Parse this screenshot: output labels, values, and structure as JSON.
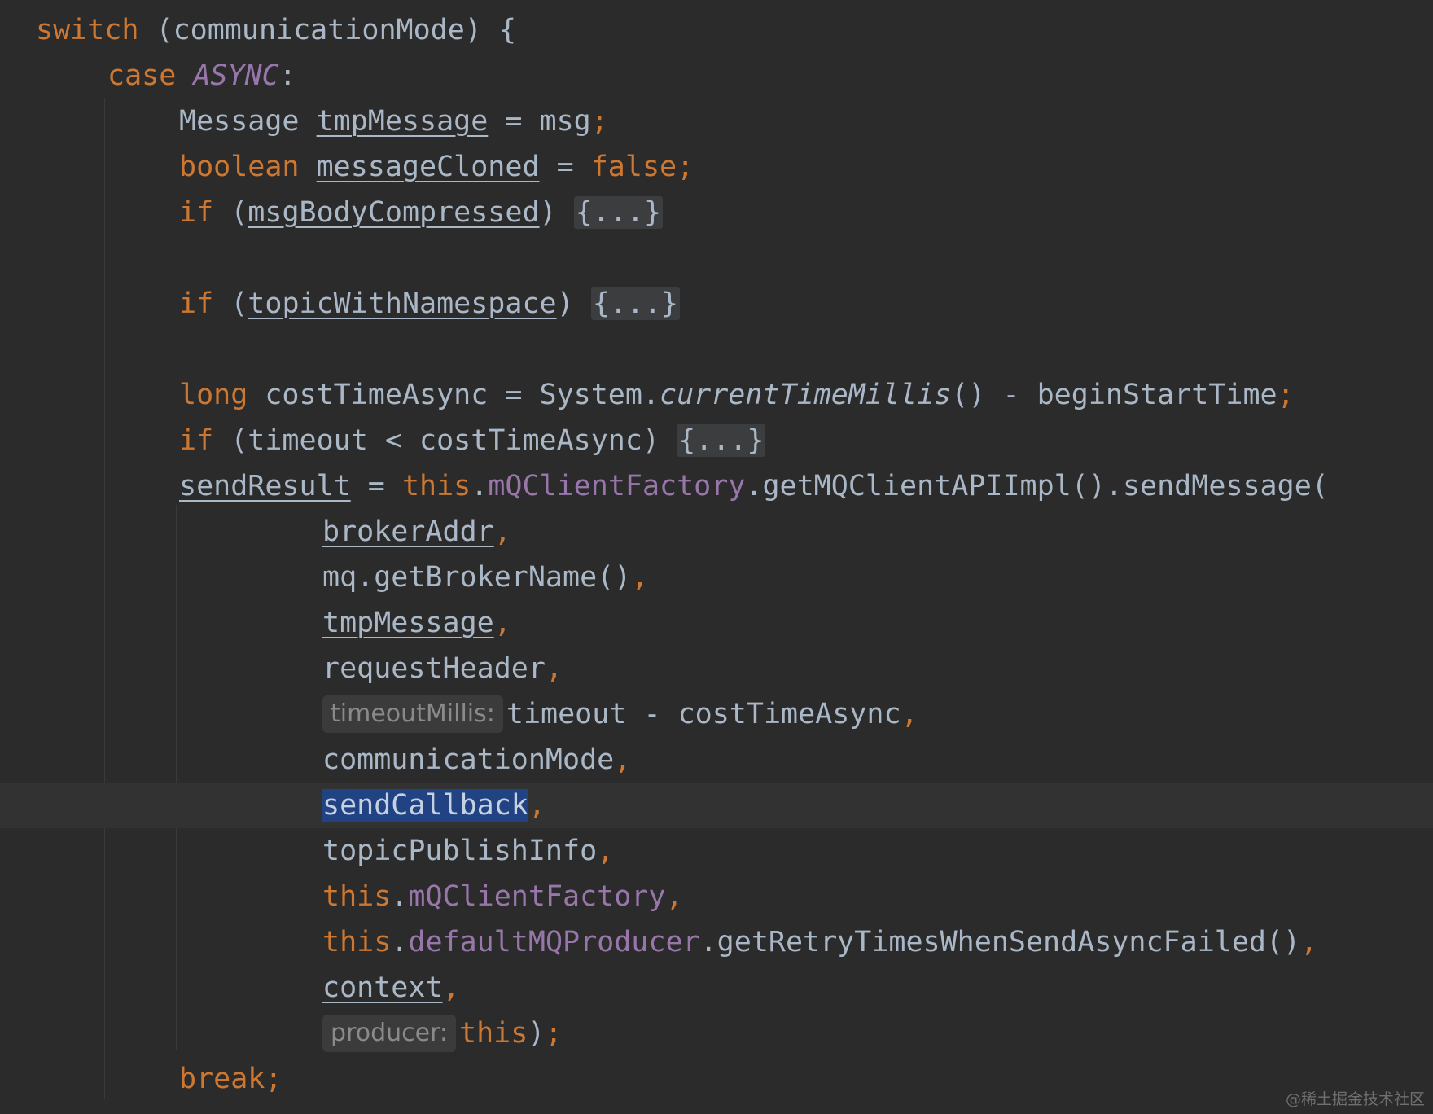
{
  "colors": {
    "background": "#2b2b2b",
    "keyword": "#cc7832",
    "identifier": "#a9b7c6",
    "field": "#9876aa",
    "selection": "#214283",
    "hint_text": "#8a8a8a"
  },
  "code_lines": [
    {
      "indent": 0,
      "tokens": [
        {
          "t": "switch",
          "c": "kw"
        },
        {
          "t": " (communicationMode) {",
          "c": "plain"
        }
      ]
    },
    {
      "indent": 1,
      "tokens": [
        {
          "t": "case ",
          "c": "kw"
        },
        {
          "t": "ASYNC",
          "c": "enum"
        },
        {
          "t": ":",
          "c": "plain"
        }
      ]
    },
    {
      "indent": 2,
      "tokens": [
        {
          "t": "Message ",
          "c": "plain"
        },
        {
          "t": "tmpMessage",
          "c": "plain u"
        },
        {
          "t": " = msg",
          "c": "plain"
        },
        {
          "t": ";",
          "c": "kw"
        }
      ]
    },
    {
      "indent": 2,
      "tokens": [
        {
          "t": "boolean ",
          "c": "kw"
        },
        {
          "t": "messageCloned",
          "c": "plain u"
        },
        {
          "t": " = ",
          "c": "plain"
        },
        {
          "t": "false",
          "c": "kw"
        },
        {
          "t": ";",
          "c": "kw"
        }
      ]
    },
    {
      "indent": 2,
      "tokens": [
        {
          "t": "if ",
          "c": "kw"
        },
        {
          "t": "(",
          "c": "plain"
        },
        {
          "t": "msgBodyCompressed",
          "c": "plain u"
        },
        {
          "t": ") ",
          "c": "plain"
        },
        {
          "t": "{...}",
          "c": "fold"
        }
      ]
    },
    {
      "indent": 2,
      "tokens": []
    },
    {
      "indent": 2,
      "tokens": [
        {
          "t": "if ",
          "c": "kw"
        },
        {
          "t": "(",
          "c": "plain"
        },
        {
          "t": "topicWithNamespace",
          "c": "plain u"
        },
        {
          "t": ") ",
          "c": "plain"
        },
        {
          "t": "{...}",
          "c": "fold"
        }
      ]
    },
    {
      "indent": 2,
      "tokens": []
    },
    {
      "indent": 2,
      "tokens": [
        {
          "t": "long ",
          "c": "kw"
        },
        {
          "t": "costTimeAsync = System.",
          "c": "plain"
        },
        {
          "t": "currentTimeMillis",
          "c": "static-call"
        },
        {
          "t": "() - beginStartTime",
          "c": "plain"
        },
        {
          "t": ";",
          "c": "kw"
        }
      ]
    },
    {
      "indent": 2,
      "tokens": [
        {
          "t": "if ",
          "c": "kw"
        },
        {
          "t": "(timeout < costTimeAsync) ",
          "c": "plain"
        },
        {
          "t": "{...}",
          "c": "fold"
        }
      ]
    },
    {
      "indent": 2,
      "tokens": [
        {
          "t": "sendResult",
          "c": "plain u"
        },
        {
          "t": " = ",
          "c": "plain"
        },
        {
          "t": "this",
          "c": "kw"
        },
        {
          "t": ".",
          "c": "plain"
        },
        {
          "t": "mQClientFactory",
          "c": "field"
        },
        {
          "t": ".getMQClientAPIImpl().sendMessage(",
          "c": "plain"
        }
      ]
    },
    {
      "indent": 4,
      "tokens": [
        {
          "t": "brokerAddr",
          "c": "plain u"
        },
        {
          "t": ",",
          "c": "kw"
        }
      ]
    },
    {
      "indent": 4,
      "tokens": [
        {
          "t": "mq.getBrokerName()",
          "c": "plain"
        },
        {
          "t": ",",
          "c": "kw"
        }
      ]
    },
    {
      "indent": 4,
      "tokens": [
        {
          "t": "tmpMessage",
          "c": "plain u"
        },
        {
          "t": ",",
          "c": "kw"
        }
      ]
    },
    {
      "indent": 4,
      "tokens": [
        {
          "t": "requestHeader",
          "c": "plain"
        },
        {
          "t": ",",
          "c": "kw"
        }
      ]
    },
    {
      "indent": 4,
      "tokens": [
        {
          "t": "timeoutMillis:",
          "c": "hint"
        },
        {
          "t": "timeout - costTimeAsync",
          "c": "plain"
        },
        {
          "t": ",",
          "c": "kw"
        }
      ]
    },
    {
      "indent": 4,
      "tokens": [
        {
          "t": "communicationMode",
          "c": "plain"
        },
        {
          "t": ",",
          "c": "kw"
        }
      ]
    },
    {
      "indent": 4,
      "caret": true,
      "tokens": [
        {
          "t": "sendCallback",
          "c": "sel"
        },
        {
          "t": ",",
          "c": "kw"
        }
      ]
    },
    {
      "indent": 4,
      "tokens": [
        {
          "t": "topicPublishInfo",
          "c": "plain"
        },
        {
          "t": ",",
          "c": "kw"
        }
      ]
    },
    {
      "indent": 4,
      "tokens": [
        {
          "t": "this",
          "c": "kw"
        },
        {
          "t": ".",
          "c": "plain"
        },
        {
          "t": "mQClientFactory",
          "c": "field"
        },
        {
          "t": ",",
          "c": "kw"
        }
      ]
    },
    {
      "indent": 4,
      "tokens": [
        {
          "t": "this",
          "c": "kw"
        },
        {
          "t": ".",
          "c": "plain"
        },
        {
          "t": "defaultMQProducer",
          "c": "field"
        },
        {
          "t": ".getRetryTimesWhenSendAsyncFailed()",
          "c": "plain"
        },
        {
          "t": ",",
          "c": "kw"
        }
      ]
    },
    {
      "indent": 4,
      "tokens": [
        {
          "t": "context",
          "c": "plain u"
        },
        {
          "t": ",",
          "c": "kw"
        }
      ]
    },
    {
      "indent": 4,
      "tokens": [
        {
          "t": "producer:",
          "c": "hint"
        },
        {
          "t": "this",
          "c": "kw"
        },
        {
          "t": ")",
          "c": "plain"
        },
        {
          "t": ";",
          "c": "kw"
        }
      ]
    },
    {
      "indent": 2,
      "tokens": [
        {
          "t": "break",
          "c": "kw"
        },
        {
          "t": ";",
          "c": "kw"
        }
      ]
    }
  ],
  "watermark": "@稀土掘金技术社区"
}
